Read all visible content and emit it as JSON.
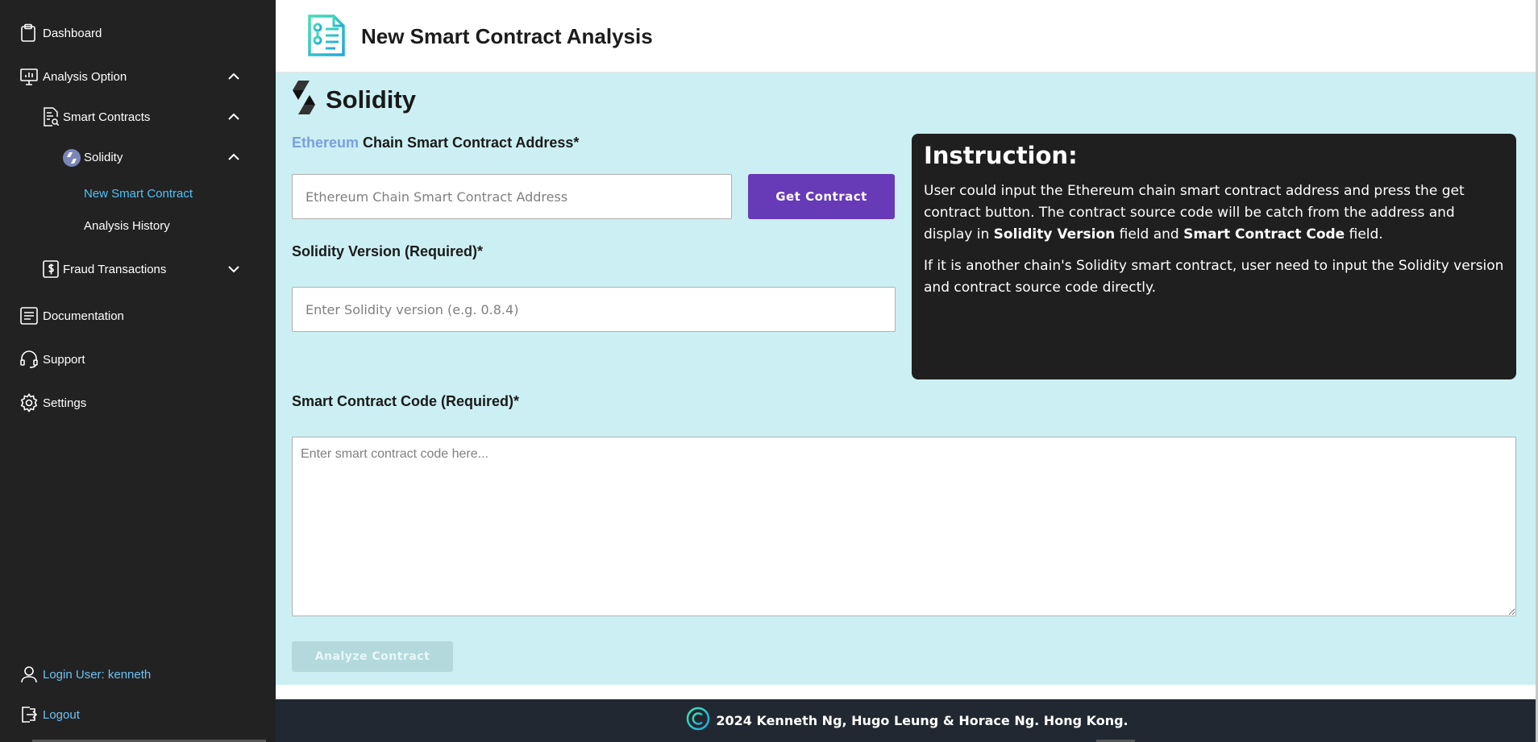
{
  "sidebar": {
    "dashboard": "Dashboard",
    "analysis_option": "Analysis Option",
    "smart_contracts": "Smart Contracts",
    "solidity": "Solidity",
    "new_smart_contract": "New Smart Contract",
    "analysis_history": "Analysis History",
    "fraud_transactions": "Fraud Transactions",
    "documentation": "Documentation",
    "support": "Support",
    "settings": "Settings",
    "login_user": "Login User: kenneth",
    "logout": "Logout"
  },
  "header": {
    "title": "New Smart Contract Analysis"
  },
  "main": {
    "language_title": "Solidity",
    "address_label_chain": "Ethereum",
    "address_label_rest": " Chain Smart Contract Address*",
    "address_placeholder": "Ethereum Chain Smart Contract Address",
    "get_contract_button": "Get Contract",
    "version_label": "Solidity Version (Required)*",
    "version_placeholder": "Enter Solidity version (e.g. 0.8.4)",
    "code_label": "Smart Contract Code (Required)*",
    "code_placeholder": "Enter smart contract code here...",
    "analyze_button": "Analyze Contract"
  },
  "instruction": {
    "title": "Instruction:",
    "p1_a": "User could input the Ethereum chain smart contract address and press the get contract button. The contract source code will be catch from the address and display in ",
    "p1_b": "Solidity Version",
    "p1_c": " field and ",
    "p1_d": "Smart Contract Code",
    "p1_e": " field.",
    "p2": "If it is another chain's Solidity smart contract, user need to input the Solidity version and contract source code directly."
  },
  "footer": {
    "text": "2024 Kenneth Ng, Hugo Leung & Horace Ng. Hong Kong."
  },
  "colors": {
    "sidebar_bg": "#222222",
    "main_bg": "#cceff3",
    "accent_purple": "#673ab7",
    "active_link": "#4fc3f7",
    "ethereum_text": "#7a9fe0",
    "footer_bg": "#222831"
  }
}
